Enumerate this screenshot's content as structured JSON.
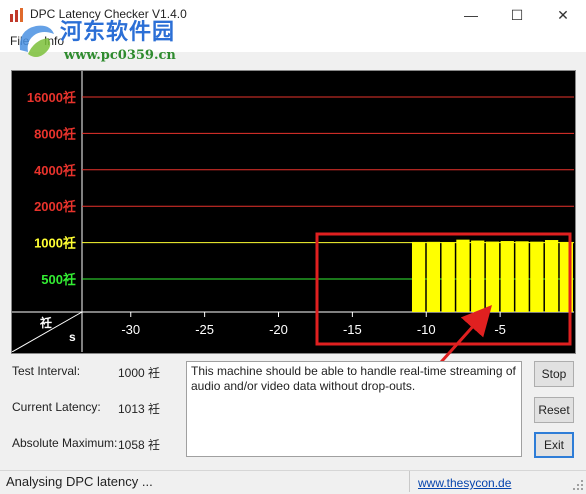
{
  "window": {
    "title": "DPC Latency Checker V1.4.0",
    "minimize_glyph": "—",
    "maximize_glyph": "☐",
    "close_glyph": "✕"
  },
  "menu": {
    "items": [
      "File",
      "Info"
    ]
  },
  "watermark": {
    "text": "河东软件园",
    "url": "www.pc0359.cn"
  },
  "chart_data": {
    "type": "bar",
    "y_ticks": [
      {
        "label": "16000",
        "unit": "祍",
        "value": 16000,
        "color": "#e8332c"
      },
      {
        "label": "8000",
        "unit": "祍",
        "value": 8000,
        "color": "#e8332c"
      },
      {
        "label": "4000",
        "unit": "祍",
        "value": 4000,
        "color": "#e8332c"
      },
      {
        "label": "2000",
        "unit": "祍",
        "value": 2000,
        "color": "#e8332c"
      },
      {
        "label": "1000",
        "unit": "祍",
        "value": 1000,
        "color": "#ffff33"
      },
      {
        "label": "500",
        "unit": "祍",
        "value": 500,
        "color": "#33ee33"
      }
    ],
    "y_scale": "log",
    "x_ticks": [
      -30,
      -25,
      -20,
      -15,
      -10,
      -5
    ],
    "x_range": [
      -33.3,
      0
    ],
    "corner_unit_y": "祍",
    "corner_unit_x": "s",
    "bar_color": "#ffff00",
    "bars_x": [
      -10.5,
      -9.5,
      -8.5,
      -7.5,
      -6.5,
      -5.5,
      -4.5,
      -3.5,
      -2.5,
      -1.5,
      -0.5
    ],
    "bars_values": [
      1013,
      1015,
      1012,
      1058,
      1040,
      1020,
      1030,
      1025,
      1018,
      1050,
      1013
    ],
    "highlight_color": "#e02020"
  },
  "panel": {
    "test_interval_label": "Test Interval:",
    "test_interval_value": "1000 祍",
    "current_latency_label": "Current Latency:",
    "current_latency_value": "1013 祍",
    "absolute_max_label": "Absolute Maximum:",
    "absolute_max_value": "1058 祍",
    "message": "This machine should be able to handle real-time streaming of audio and/or video data without drop-outs."
  },
  "buttons": {
    "stop": "Stop",
    "reset": "Reset",
    "exit": "Exit"
  },
  "status": {
    "text": "Analysing DPC latency ...",
    "link": "www.thesycon.de"
  }
}
